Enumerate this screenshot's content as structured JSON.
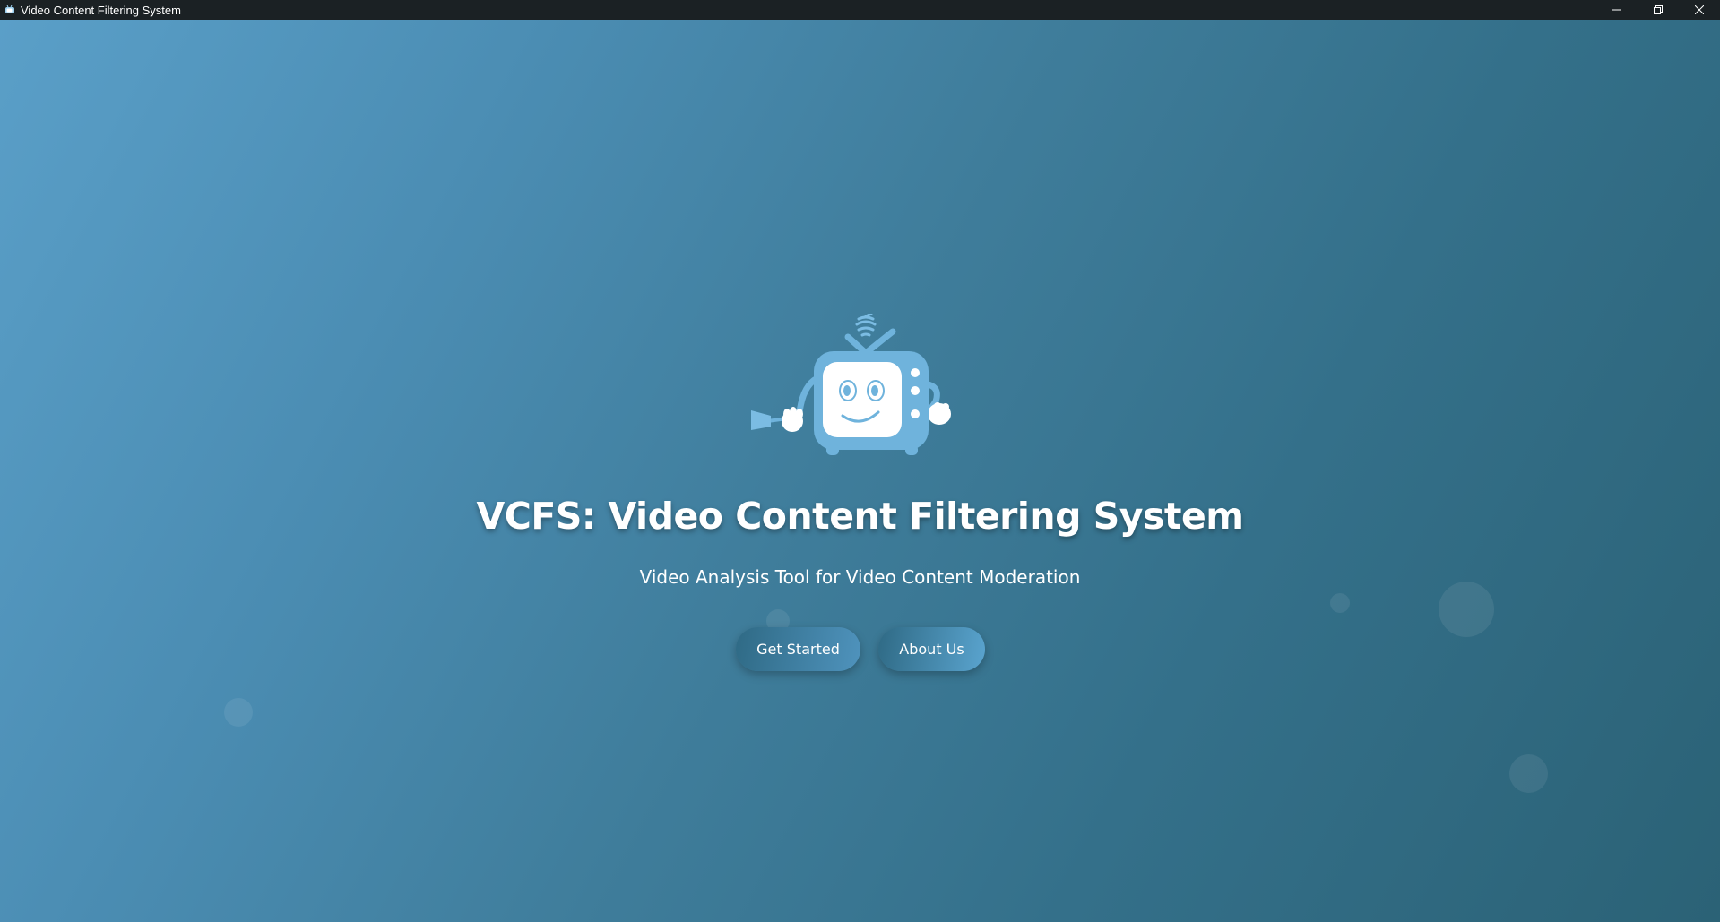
{
  "window": {
    "title": "Video Content Filtering System",
    "controls": {
      "minimize_icon": "minimize-icon",
      "maximize_icon": "restore-icon",
      "close_icon": "close-icon"
    }
  },
  "hero": {
    "mascot_icon": "tv-mascot-icon",
    "title": "VCFS: Video Content Filtering System",
    "subtitle": "Video Analysis Tool for Video Content Moderation",
    "buttons": {
      "get_started": "Get Started",
      "about_us": "About Us"
    }
  },
  "colors": {
    "gradient_start": "#5a9fc8",
    "gradient_end": "#2b6276",
    "titlebar": "#1b2124",
    "mascot": "#6fb3dc",
    "text": "#ffffff"
  }
}
